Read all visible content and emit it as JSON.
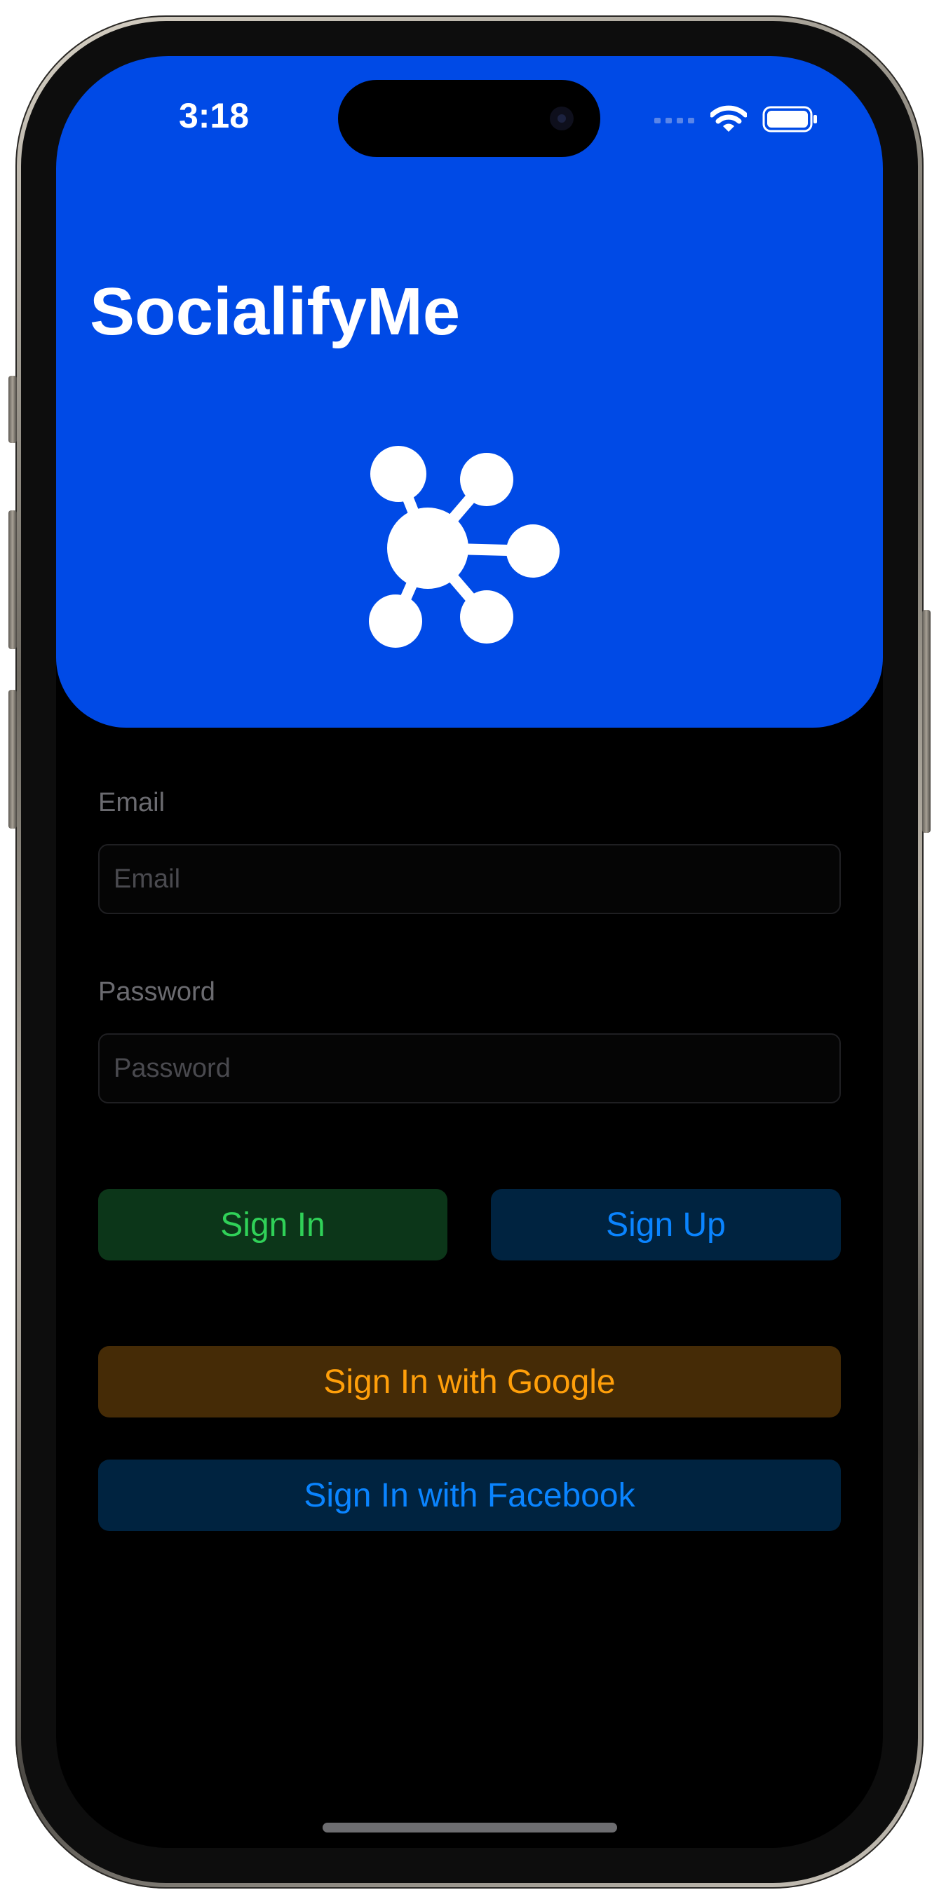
{
  "status_bar": {
    "time": "3:18"
  },
  "header": {
    "app_title": "SocialifyMe",
    "background_color": "#004ae6",
    "logo_icon": "network-hub-icon"
  },
  "form": {
    "email": {
      "label": "Email",
      "placeholder": "Email",
      "value": ""
    },
    "password": {
      "label": "Password",
      "placeholder": "Password",
      "value": ""
    }
  },
  "buttons": {
    "sign_in": {
      "label": "Sign In",
      "text_color": "#30d158",
      "bg_color": "#0c3619"
    },
    "sign_up": {
      "label": "Sign Up",
      "text_color": "#0a84ff",
      "bg_color": "#002340"
    },
    "google": {
      "label": "Sign In with Google",
      "text_color": "#ff9f0a",
      "bg_color": "#452b06"
    },
    "facebook": {
      "label": "Sign In with Facebook",
      "text_color": "#0a84ff",
      "bg_color": "#002340"
    }
  }
}
